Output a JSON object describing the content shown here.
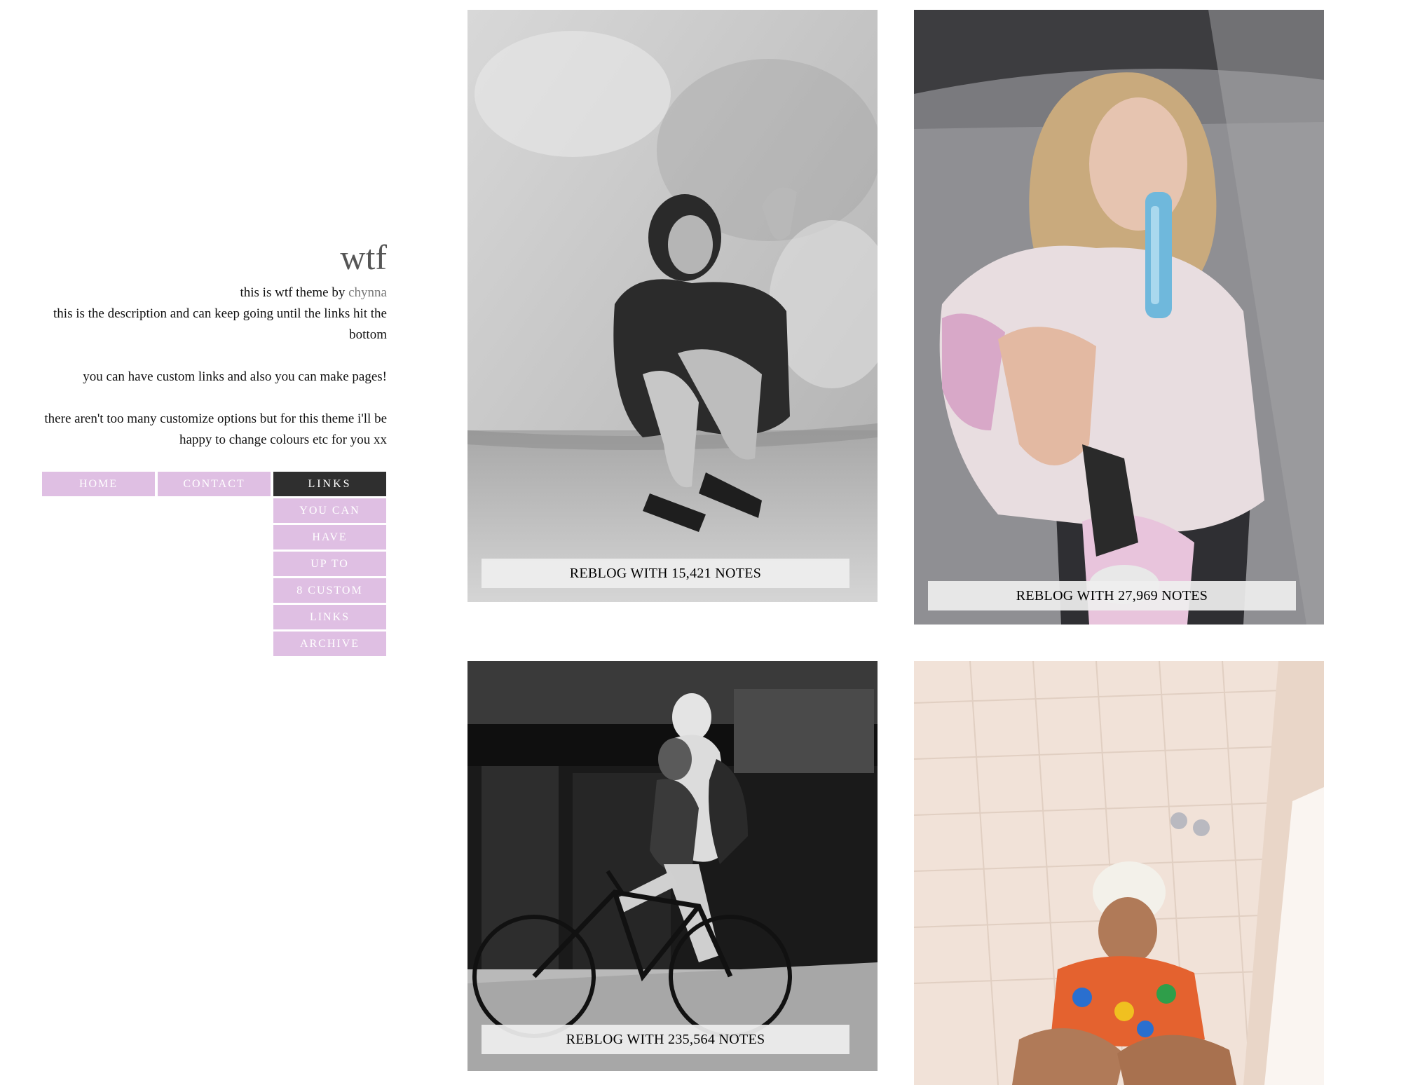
{
  "blog": {
    "title": "wtf",
    "description": {
      "line1_prefix": "this is wtf theme by ",
      "author": "chynna",
      "line2": "this is the description and can keep going until the links hit the bottom",
      "line3": "you can have custom links and also you can make pages!",
      "line4": "there aren't too many customize options but for this theme i'll be happy to change colours etc for you xx"
    }
  },
  "nav": {
    "home": "HOME",
    "contact": "CONTACT",
    "links": "LINKS",
    "sublinks": [
      "YOU CAN",
      "HAVE",
      "UP TO",
      "8 CUSTOM",
      "LINKS",
      "ARCHIVE"
    ]
  },
  "posts": [
    {
      "reblog": "REBLOG WITH 15,421 NOTES"
    },
    {
      "reblog": "REBLOG WITH 27,969 NOTES"
    },
    {
      "reblog": "REBLOG WITH 235,564 NOTES"
    },
    {
      "reblog": ""
    }
  ],
  "colors": {
    "nav_button": "#dfbfe3",
    "nav_active": "#2f2f2f",
    "title": "#555555"
  }
}
